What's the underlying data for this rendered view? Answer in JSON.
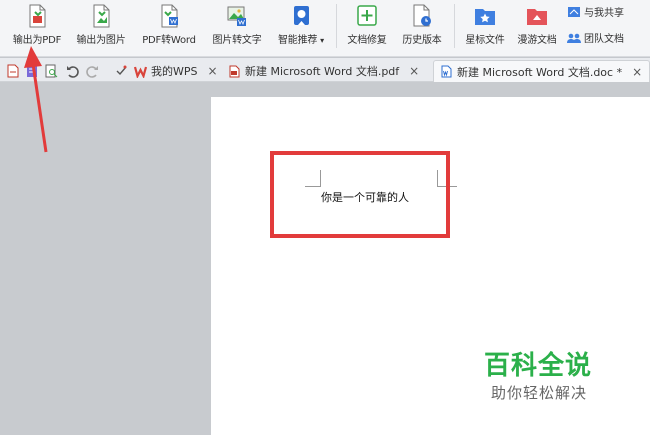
{
  "ribbon": {
    "buttons": [
      {
        "label": "输出为PDF",
        "icon": "export-pdf-icon"
      },
      {
        "label": "输出为图片",
        "icon": "export-image-icon"
      },
      {
        "label": "PDF转Word",
        "icon": "pdf-to-word-icon"
      },
      {
        "label": "图片转文字",
        "icon": "image-to-text-icon"
      },
      {
        "label": "智能推荐",
        "icon": "smart-recommend-icon"
      },
      {
        "label": "文档修复",
        "icon": "doc-repair-icon"
      },
      {
        "label": "历史版本",
        "icon": "history-version-icon"
      },
      {
        "label": "星标文件",
        "icon": "star-file-icon"
      },
      {
        "label": "漫游文档",
        "icon": "roaming-doc-icon"
      }
    ],
    "dropdown_caret": "▾",
    "share_label": "与我共享",
    "team_label": "团队文档"
  },
  "tabs": [
    {
      "label": "我的WPS",
      "icon": "wps-logo-icon",
      "close": "×"
    },
    {
      "label": "新建 Microsoft Word 文档.pdf",
      "icon": "pdf-file-icon",
      "close": "×"
    },
    {
      "label": "新建 Microsoft Word 文档.doc *",
      "icon": "word-file-icon",
      "active": true,
      "close": "×"
    }
  ],
  "document": {
    "text": "你是一个可靠的人"
  },
  "watermark": {
    "title": "百科全说",
    "subtitle": "助你轻松解决"
  },
  "colors": {
    "highlight": "#e23b3b",
    "arrow": "#e23b3b",
    "watermark": "#2bb04a"
  }
}
